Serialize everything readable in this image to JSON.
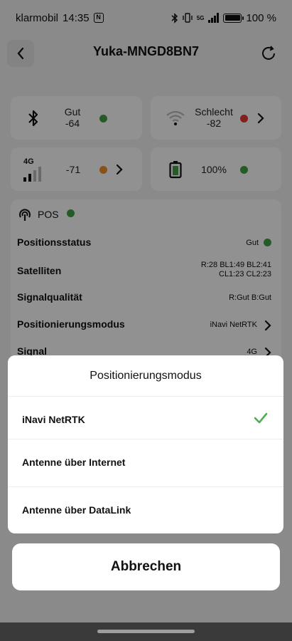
{
  "status_bar": {
    "carrier": "klarmobil",
    "time": "14:35",
    "nfc_text": "N",
    "network": "5G",
    "battery_percent": "100 %"
  },
  "header": {
    "title": "Yuka-MNGD8BN7"
  },
  "tiles": {
    "bluetooth": {
      "quality": "Gut",
      "value": "-64",
      "status_color": "#43a047"
    },
    "wifi": {
      "quality": "Schlecht",
      "value": "-82",
      "status_color": "#e53935"
    },
    "cellular": {
      "network": "4G",
      "value": "-71",
      "status_color": "#f0932b"
    },
    "battery": {
      "value": "100%",
      "status_color": "#43a047"
    }
  },
  "pos": {
    "title": "POS",
    "status_color": "#43a047",
    "rows": [
      {
        "label": "Positionsstatus",
        "value": "Gut"
      },
      {
        "label": "Satelliten",
        "value_line1": "R:28  BL1:49  BL2:41",
        "value_line2": "CL1:23  CL2:23"
      },
      {
        "label": "Signalqualität",
        "value": "R:Gut  B:Gut"
      },
      {
        "label": "Positionierungsmodus",
        "value": "iNavi NetRTK"
      },
      {
        "label": "Signal",
        "value": "4G"
      }
    ]
  },
  "sheet": {
    "title": "Positionierungsmodus",
    "options": [
      {
        "label": "iNavi NetRTK",
        "selected": true
      },
      {
        "label": "Antenne über Internet",
        "selected": false
      },
      {
        "label": "Antenne über DataLink",
        "selected": false
      }
    ],
    "check_color": "#4caf50"
  },
  "cancel_label": "Abbrechen"
}
